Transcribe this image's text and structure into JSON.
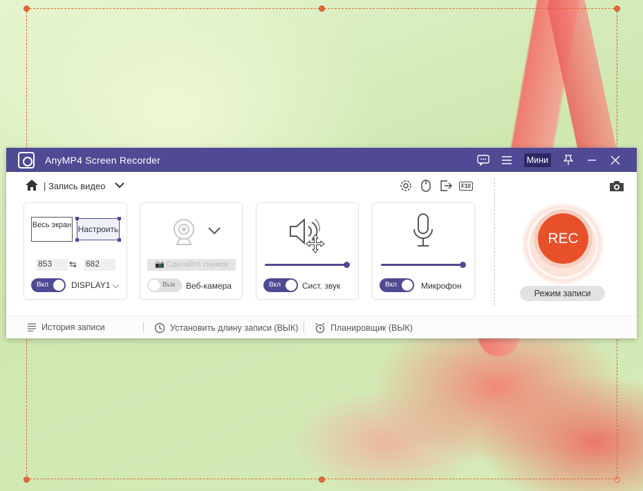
{
  "window": {
    "title": "AnyMP4 Screen Recorder",
    "mini_label": "Мини"
  },
  "toolbar": {
    "mode_label": "| Запись видео"
  },
  "display": {
    "fullscreen_label": "Весь экран",
    "custom_label": "Настроить",
    "width_value": "853",
    "height_value": "682",
    "toggle_label": "Вкл",
    "display_select": "DISPLAY1"
  },
  "webcam": {
    "snapshot_label": "Сделайте снимок",
    "toggle_label": "Вык",
    "name": "Веб-камера"
  },
  "sound": {
    "toggle_label": "Вкл",
    "name": "Сист. звук",
    "volume": 1.0
  },
  "mic": {
    "toggle_label": "Вкл",
    "name": "Микрофон",
    "volume": 1.0
  },
  "record": {
    "rec_label": "REC",
    "mode_label": "Режим записи"
  },
  "bottom": {
    "history_label": "История записи",
    "length_label": "Установить длину записи (ВЫК)",
    "scheduler_label": "Планировщик (ВЫК)"
  },
  "colors": {
    "accent": "#4f4a93",
    "rec": "#e8502a",
    "selection": "#e06a3c"
  }
}
